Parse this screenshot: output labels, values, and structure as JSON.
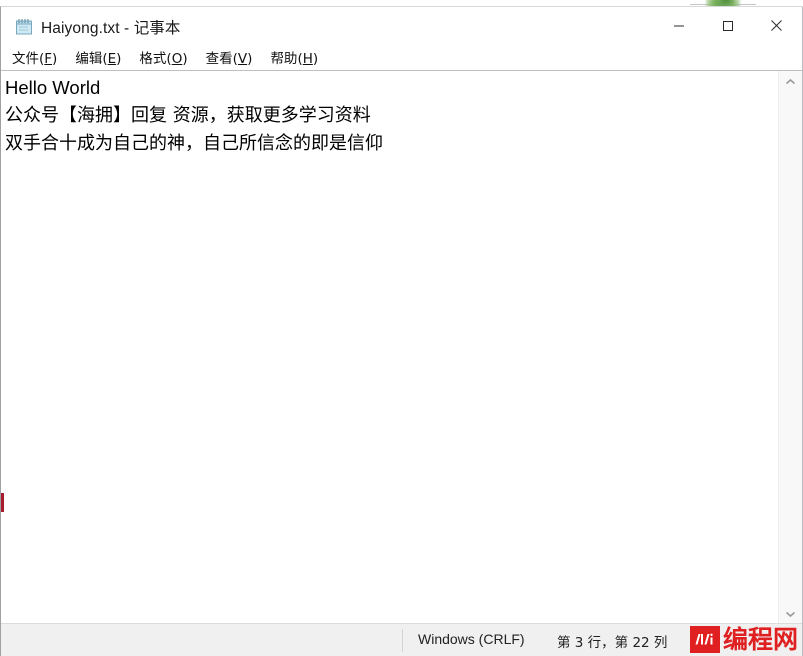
{
  "window": {
    "title": "Haiyong.txt - 记事本",
    "app_icon": "notepad-icon",
    "controls": {
      "minimize": "最小化",
      "maximize": "最大化",
      "close": "关闭"
    }
  },
  "menu": {
    "items": [
      {
        "label": "文件",
        "accel": "F"
      },
      {
        "label": "编辑",
        "accel": "E"
      },
      {
        "label": "格式",
        "accel": "O"
      },
      {
        "label": "查看",
        "accel": "V"
      },
      {
        "label": "帮助",
        "accel": "H"
      }
    ]
  },
  "editor": {
    "lines": [
      "Hello World",
      "公众号【海拥】回复 资源，获取更多学习资料",
      "双手合十成为自己的神，自己所信念的即是信仰"
    ]
  },
  "scrollbar": {
    "up_arrow": "scroll-up-icon",
    "down_arrow": "scroll-down-icon"
  },
  "statusbar": {
    "line_ending": "Windows (CRLF)",
    "caret_position": "第 3 行，第 22 列"
  },
  "watermark": {
    "badge": "编程网-logo-icon",
    "text": "编程网"
  },
  "colors": {
    "accent_red": "#e02020",
    "titlebar_bg": "#ffffff",
    "statusbar_bg": "#f0f0f0",
    "editor_bg": "#ffffff",
    "behind_window_sliver": "#a51c30"
  }
}
